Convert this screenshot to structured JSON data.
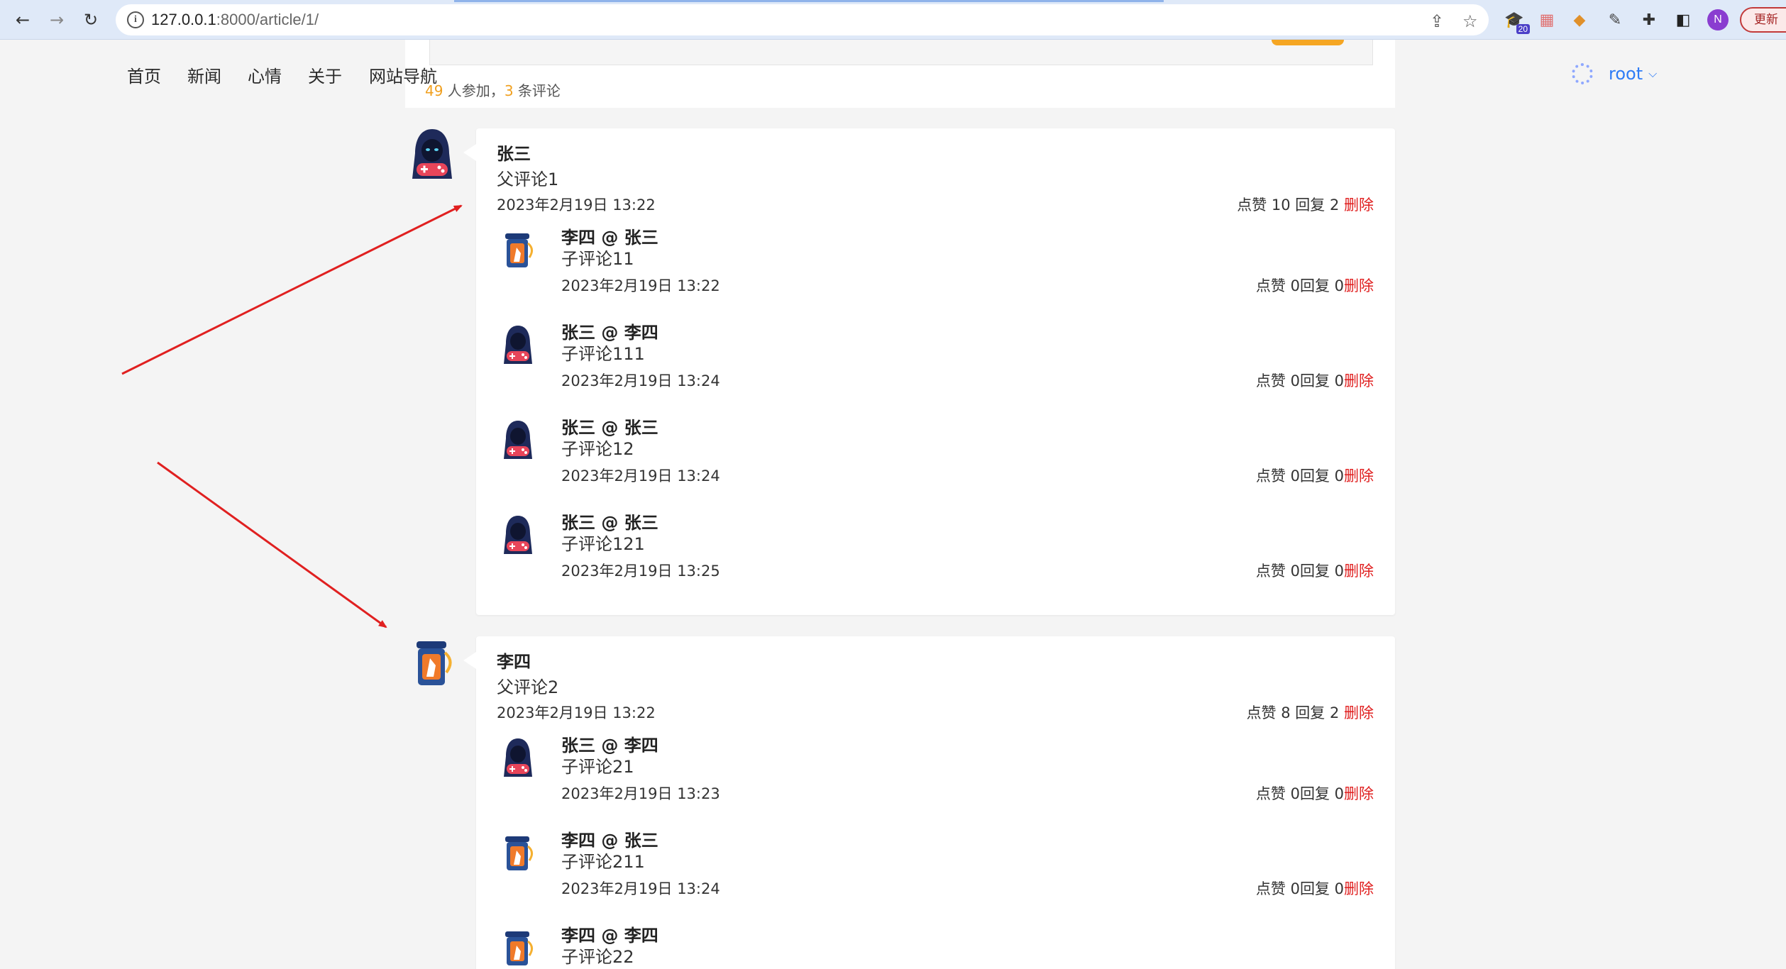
{
  "browser": {
    "url_host": "127.0.0.1",
    "url_path": ":8000/article/1/",
    "ext_badge": "20",
    "profile_initial": "N",
    "update_label": "更新"
  },
  "nav": {
    "items": [
      "首页",
      "新闻",
      "心情",
      "关于",
      "网站导航"
    ],
    "username": "root"
  },
  "article": {
    "participants": "49",
    "participants_label": " 人参加，",
    "comment_count": "3",
    "comment_label": " 条评论"
  },
  "comments": [
    {
      "author": "张三",
      "avatar": "hacker",
      "content": "父评论1",
      "time": "2023年2月19日 13:22",
      "meta": "点赞 10 回复 2 ",
      "delete": "删除",
      "replies": [
        {
          "head": "李四 @ 张三",
          "avatar": "jar",
          "text": "子评论11",
          "time": "2023年2月19日 13:22",
          "meta": "点赞 0回复 0",
          "delete": "删除"
        },
        {
          "head": "张三 @ 李四",
          "avatar": "hacker",
          "text": "子评论111",
          "time": "2023年2月19日 13:24",
          "meta": "点赞 0回复 0",
          "delete": "删除"
        },
        {
          "head": "张三 @ 张三",
          "avatar": "hacker",
          "text": "子评论12",
          "time": "2023年2月19日 13:24",
          "meta": "点赞 0回复 0",
          "delete": "删除"
        },
        {
          "head": "张三 @ 张三",
          "avatar": "hacker",
          "text": "子评论121",
          "time": "2023年2月19日 13:25",
          "meta": "点赞 0回复 0",
          "delete": "删除"
        }
      ]
    },
    {
      "author": "李四",
      "avatar": "jar",
      "content": "父评论2",
      "time": "2023年2月19日 13:22",
      "meta": "点赞 8 回复 2 ",
      "delete": "删除",
      "replies": [
        {
          "head": "张三 @ 李四",
          "avatar": "hacker",
          "text": "子评论21",
          "time": "2023年2月19日 13:23",
          "meta": "点赞 0回复 0",
          "delete": "删除"
        },
        {
          "head": "李四 @ 张三",
          "avatar": "jar",
          "text": "子评论211",
          "time": "2023年2月19日 13:24",
          "meta": "点赞 0回复 0",
          "delete": "删除"
        },
        {
          "head": "李四 @ 李四",
          "avatar": "jar",
          "text": "子评论22",
          "time": "",
          "meta": "",
          "delete": ""
        }
      ]
    }
  ],
  "colors": {
    "accent": "#2e7cf6",
    "delete": "#e02020",
    "count": "#f0a020",
    "arrow": "#e02020"
  }
}
